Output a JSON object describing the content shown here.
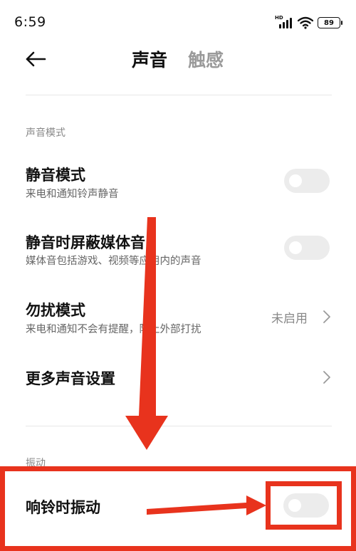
{
  "status_bar": {
    "time": "6:59",
    "network_label": "HD",
    "battery": "89"
  },
  "header": {
    "tab_active": "声音",
    "tab_inactive": "触感"
  },
  "sections": {
    "sound_mode": "声音模式",
    "vibration": "振动"
  },
  "rows": {
    "silent_mode": {
      "title": "静音模式",
      "subtitle": "来电和通知铃声静音",
      "toggle_on": false
    },
    "mute_media": {
      "title": "静音时屏蔽媒体音",
      "subtitle": "媒体音包括游戏、视频等应用内的声音",
      "toggle_on": false
    },
    "dnd": {
      "title": "勿扰模式",
      "subtitle": "来电和通知不会有提醒，防止外部打扰",
      "value": "未启用"
    },
    "more_sound": {
      "title": "更多声音设置"
    },
    "vibrate_ring": {
      "title": "响铃时振动",
      "toggle_on": false
    }
  },
  "colors": {
    "annotation_red": "#e8331d",
    "toggle_off": "#ececec",
    "text_primary": "#111111",
    "text_secondary": "#666666"
  },
  "icons": [
    "back-arrow-icon",
    "signal-icon",
    "wifi-icon",
    "battery-icon",
    "chevron-right-icon"
  ]
}
